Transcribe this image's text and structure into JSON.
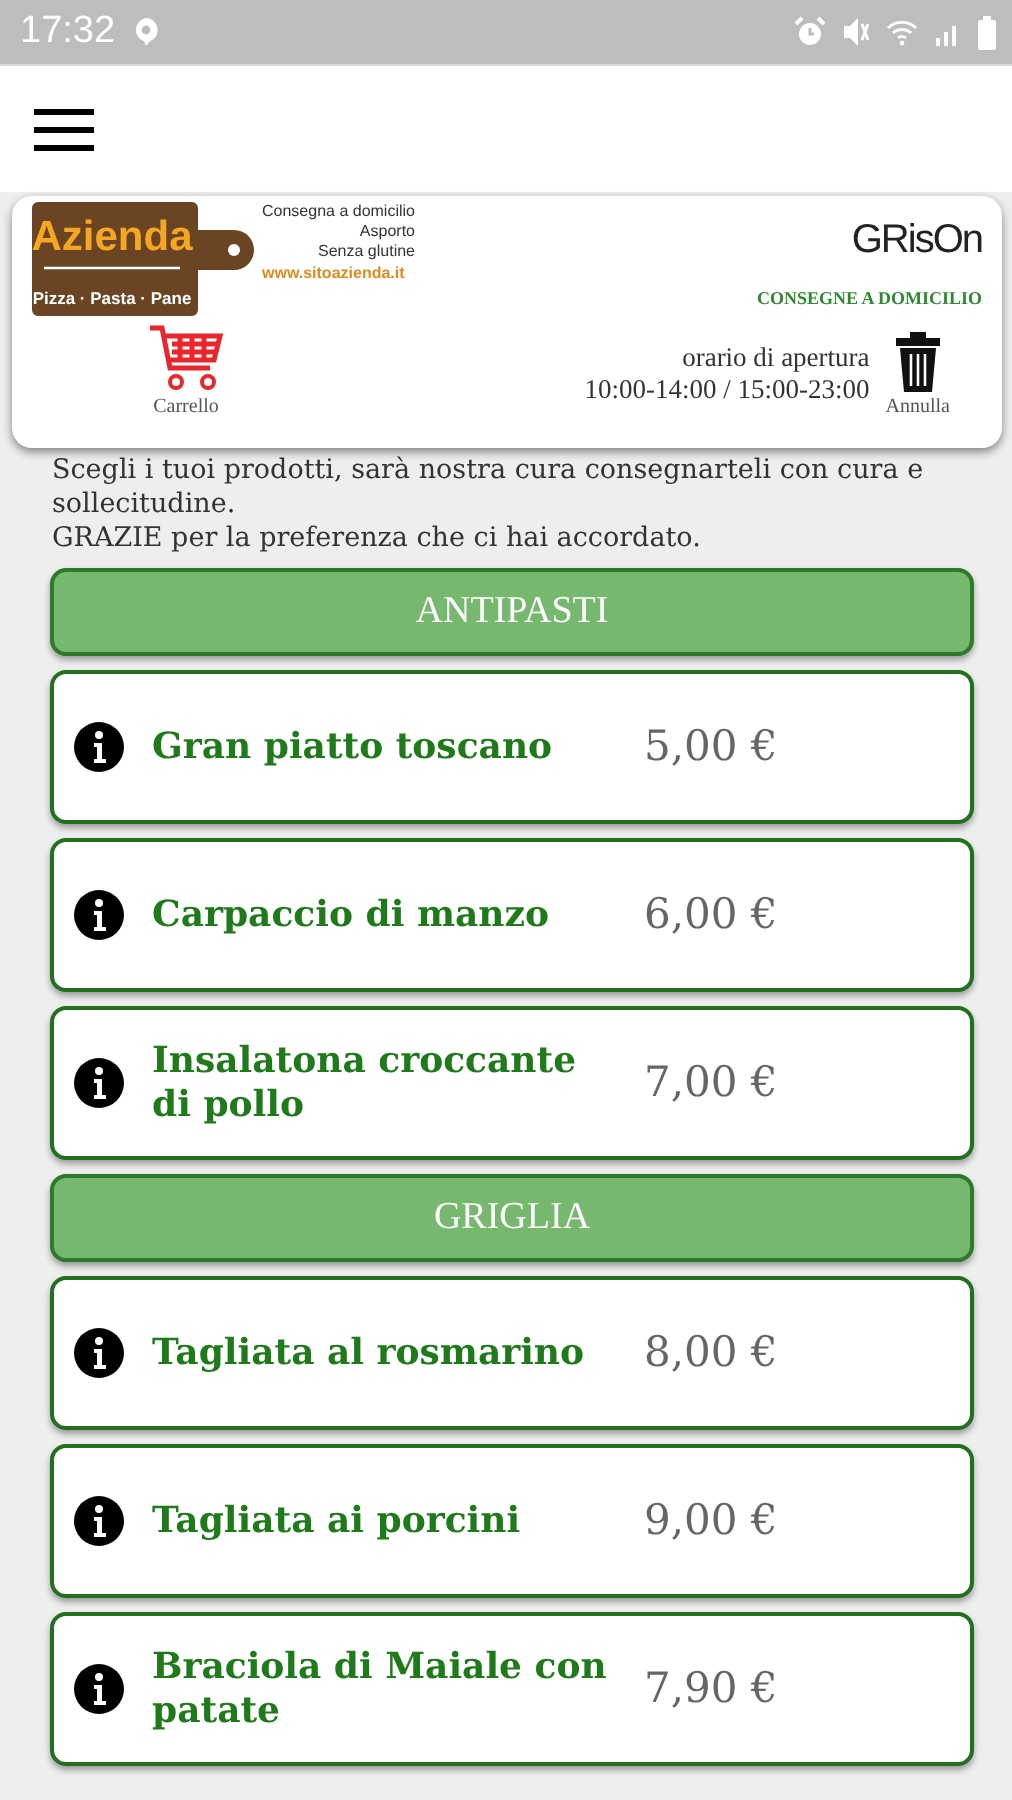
{
  "status_bar": {
    "time": "17:32"
  },
  "header": {
    "logo": {
      "name": "Azienda",
      "tagline": "Pizza · Pasta · Pane"
    },
    "services": [
      "Consegna a domicilio",
      "Asporto",
      "Senza glutine"
    ],
    "website": "www.sitoazienda.it",
    "brand": "GRisOn",
    "brand_subtitle": "CONSEGNE A DOMICILIO",
    "cart_label": "Carrello",
    "hours_title": "orario di apertura",
    "hours": "10:00-14:00 / 15:00-23:00",
    "cancel_label": "Annulla"
  },
  "intro": [
    "Scegli i tuoi prodotti, sarà nostra cura consegnarteli con cura e sollecitudine.",
    "GRAZIE per la preferenza che ci hai accordato."
  ],
  "menu": [
    {
      "kind": "section",
      "title": "ANTIPASTI"
    },
    {
      "kind": "product",
      "name": "Gran piatto toscano",
      "price": "5,00 €"
    },
    {
      "kind": "product",
      "name": "Carpaccio di manzo",
      "price": "6,00 €"
    },
    {
      "kind": "product",
      "name": "Insalatona croccante di pollo",
      "price": "7,00 €"
    },
    {
      "kind": "section",
      "title": "GRIGLIA"
    },
    {
      "kind": "product",
      "name": "Tagliata al rosmarino",
      "price": "8,00 €"
    },
    {
      "kind": "product",
      "name": "Tagliata ai porcini",
      "price": "9,00 €"
    },
    {
      "kind": "product",
      "name": "Braciola di Maiale con patate",
      "price": "7,90 €"
    }
  ]
}
